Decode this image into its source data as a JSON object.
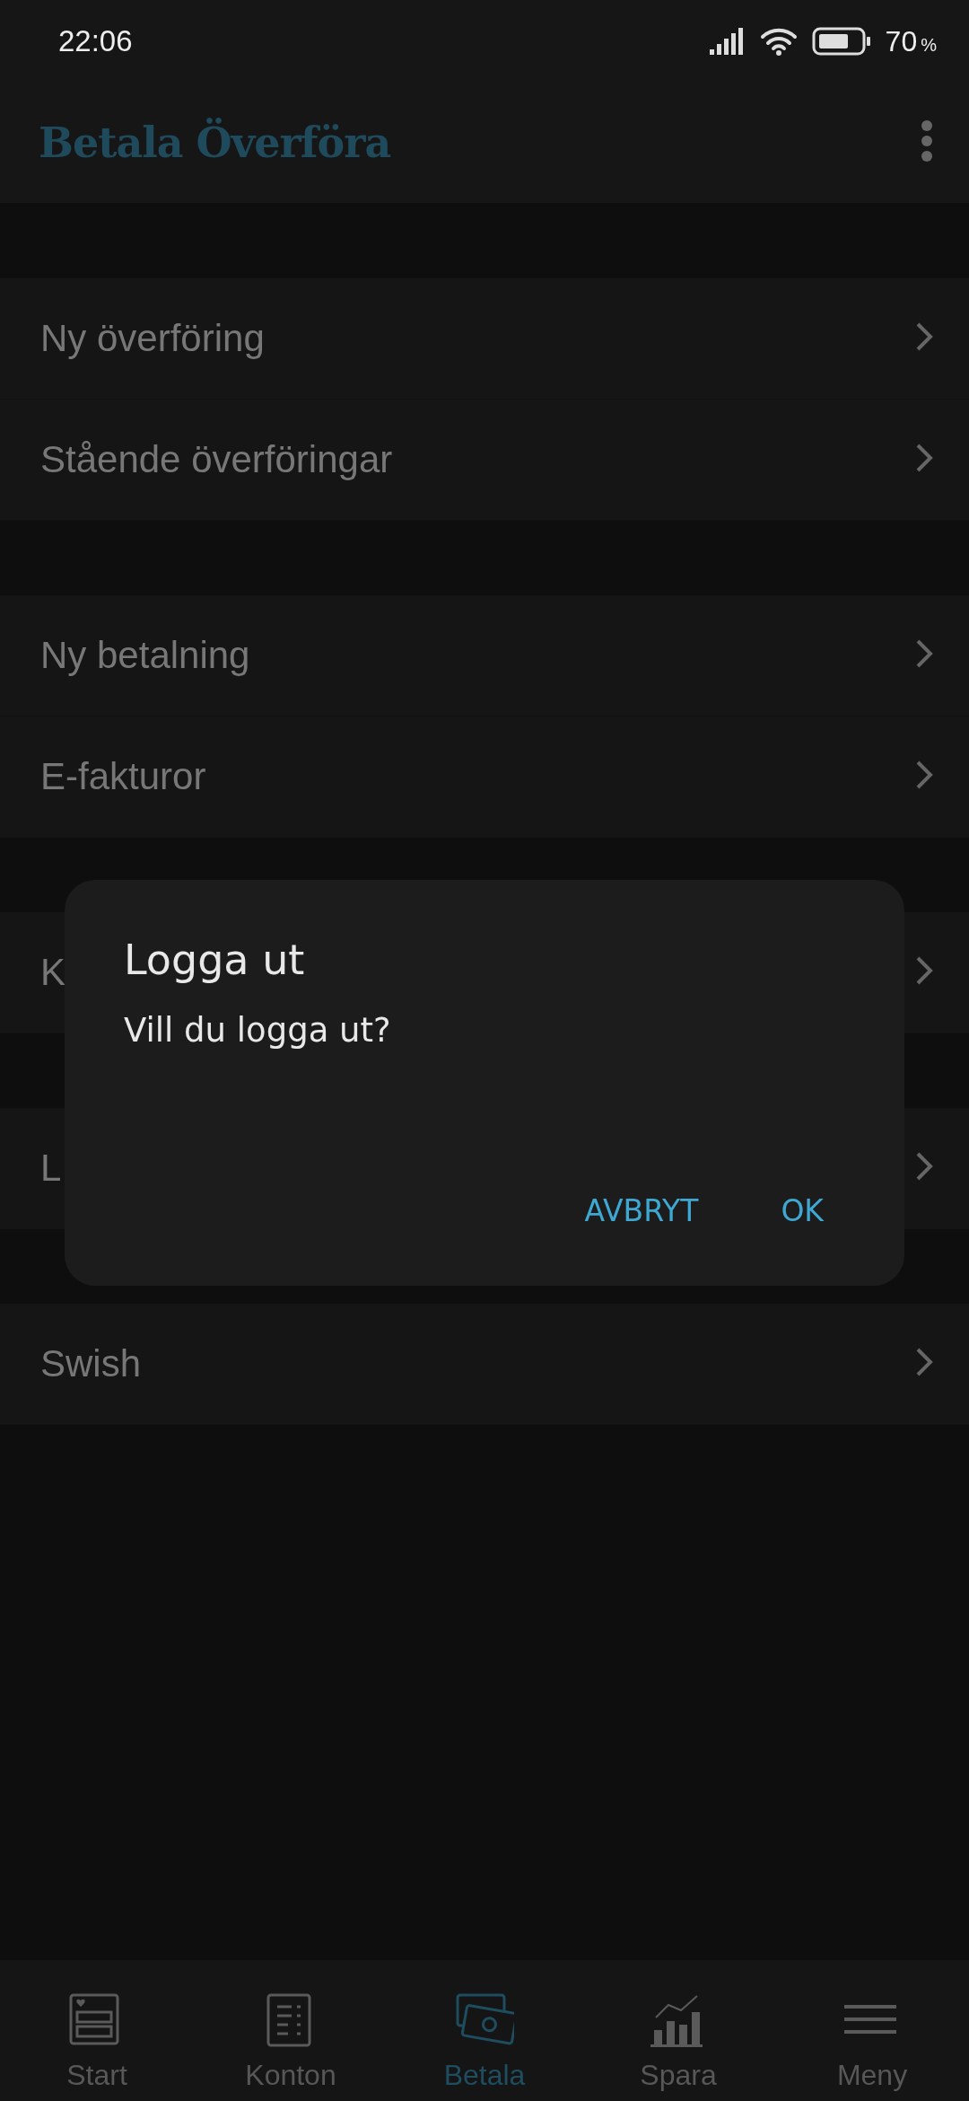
{
  "status_bar": {
    "time": "22:06",
    "battery": "70",
    "battery_unit": "%"
  },
  "header": {
    "title": "Betala Överföra"
  },
  "groups": [
    {
      "items": [
        {
          "label": "Ny överföring"
        },
        {
          "label": "Stående överföringar"
        }
      ]
    },
    {
      "items": [
        {
          "label": "Ny betalning"
        },
        {
          "label": "E-fakturor"
        }
      ]
    },
    {
      "items": [
        {
          "label": "K"
        }
      ]
    },
    {
      "items": [
        {
          "label": "L"
        }
      ]
    },
    {
      "items": [
        {
          "label": "Swish"
        }
      ]
    }
  ],
  "dialog": {
    "title": "Logga ut",
    "message": "Vill du logga ut?",
    "buttons": [
      "AVBRYT",
      "OK"
    ]
  },
  "bottom_nav": [
    {
      "label": "Start",
      "kind": "start",
      "selected": false
    },
    {
      "label": "Konton",
      "kind": "konton",
      "selected": false
    },
    {
      "label": "Betala",
      "kind": "betala",
      "selected": true
    },
    {
      "label": "Spara",
      "kind": "spara",
      "selected": false
    },
    {
      "label": "Meny",
      "kind": "meny",
      "selected": false
    }
  ]
}
